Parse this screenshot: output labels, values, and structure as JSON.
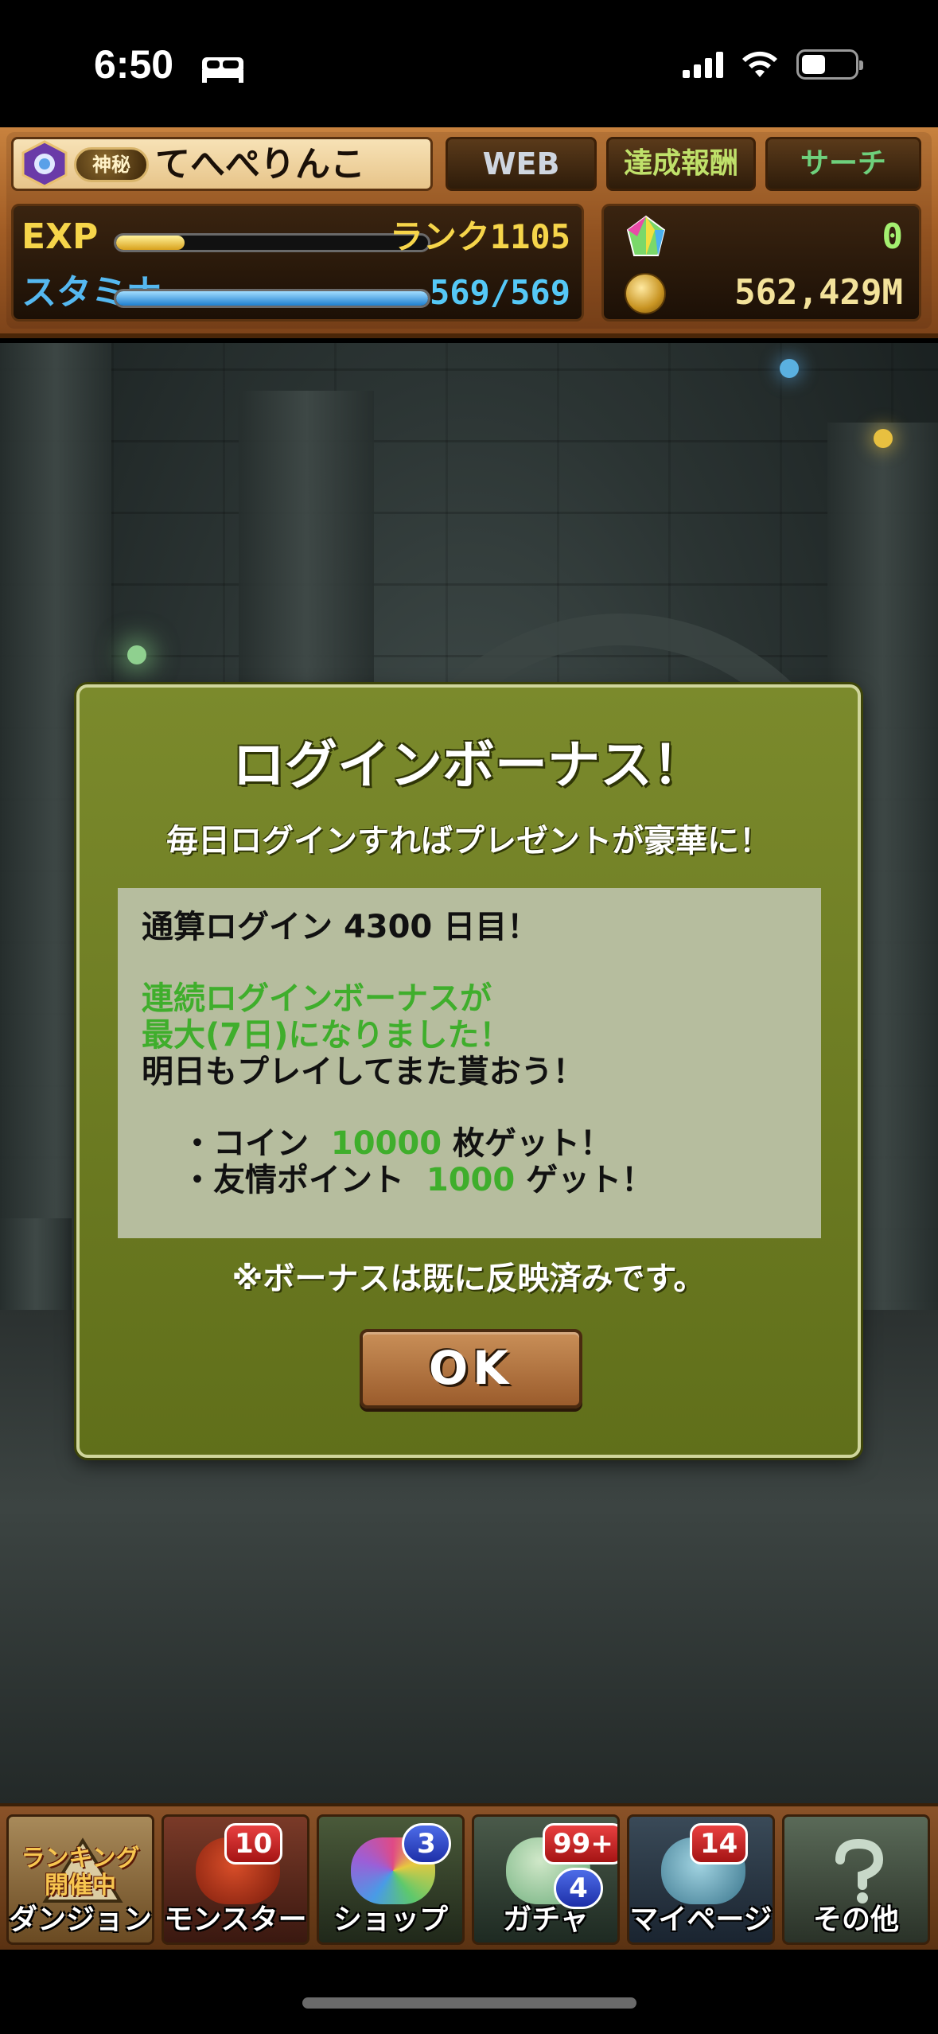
{
  "status_bar": {
    "time": "6:50",
    "icons": [
      "sleep-bed-icon",
      "signal-icon",
      "wifi-icon",
      "battery-icon"
    ]
  },
  "header": {
    "title_badge": "神秘",
    "player_name": "てへぺりんこ",
    "buttons": {
      "web": "WEB",
      "achievements": "達成報酬",
      "search": "サーチ"
    },
    "exp": {
      "label": "EXP",
      "rank_text": "ランク1105",
      "progress": 0.22
    },
    "stamina": {
      "label": "スタミナ",
      "current": 569,
      "max": 569,
      "value_text": "569/569"
    },
    "magic_stones": "0",
    "coins": "562,429M"
  },
  "dialog": {
    "title": "ログインボーナス！",
    "subtitle": "毎日ログインすればプレゼントが豪華に！",
    "total_login_prefix": "通算ログイン",
    "total_login_days": "4300",
    "total_login_suffix": "日目！",
    "streak_line1": "連続ログインボーナスが",
    "streak_line2": "最大(7日)になりました！",
    "tomorrow_line": "明日もプレイしてまた貰おう！",
    "reward1_prefix": "・コイン",
    "reward1_amount": "10000",
    "reward1_suffix": "枚ゲット！",
    "reward2_prefix": "・友情ポイント",
    "reward2_amount": "1000",
    "reward2_suffix": "ゲット！",
    "note": "※ボーナスは既に反映済みです。",
    "ok_label": "OK"
  },
  "bottom_nav": {
    "items": [
      {
        "label": "ダンジョン",
        "event": "ランキング\n開催中",
        "icon": "dungeon-icon"
      },
      {
        "label": "モンスター",
        "badge": "10",
        "icon": "monster-icon"
      },
      {
        "label": "ショップ",
        "badge": "3",
        "icon": "shop-icon"
      },
      {
        "label": "ガチャ",
        "badge": "99+",
        "badge2": "4",
        "icon": "gacha-egg-icon"
      },
      {
        "label": "マイページ",
        "badge": "14",
        "icon": "mypage-icon"
      },
      {
        "label": "その他",
        "icon": "others-question-icon"
      }
    ]
  },
  "colors": {
    "dialog_bg": "#6a7a22",
    "highlight_green": "#3fae2c",
    "header_brown": "#a25d25",
    "badge_red": "#d12828"
  }
}
